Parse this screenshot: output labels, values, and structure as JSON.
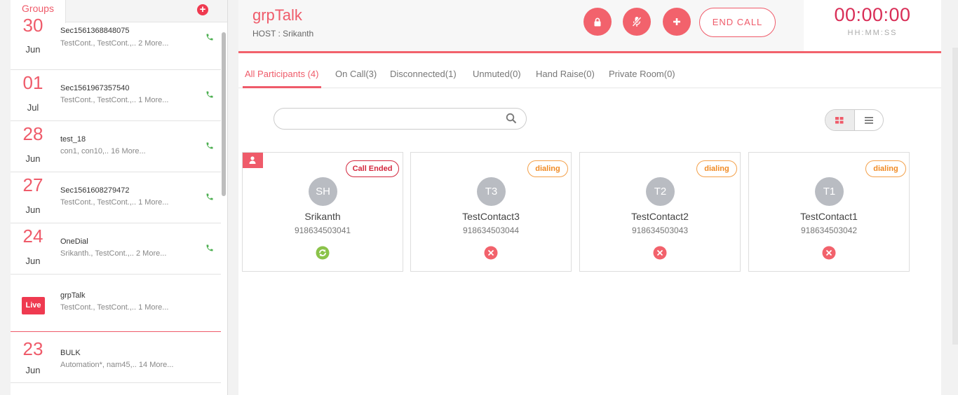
{
  "sidebar": {
    "tab_label": "Groups",
    "add_icon": "plus-circle-icon",
    "groups": [
      {
        "day": "30",
        "month": "Jun",
        "name": "Sec1561368848075",
        "members": "TestCont.,  TestCont.,.. 2 More..."
      },
      {
        "day": "01",
        "month": "Jul",
        "name": "Sec1561967357540",
        "members": "TestCont.,  TestCont.,.. 1 More..."
      },
      {
        "day": "28",
        "month": "Jun",
        "name": "test_18",
        "members": "con1,  con10,.. 16 More..."
      },
      {
        "day": "27",
        "month": "Jun",
        "name": "Sec1561608279472",
        "members": "TestCont.,  TestCont.,.. 1 More..."
      },
      {
        "day": "24",
        "month": "Jun",
        "name": "OneDial",
        "members": "Srikanth.,  TestCont.,.. 2 More..."
      },
      {
        "live": "Live",
        "name": "grpTalk",
        "members": "TestCont.,  TestCont.,.. 1 More..."
      },
      {
        "day": "23",
        "month": "Jun",
        "name": "BULK",
        "members": "Automation*,  nam45,.. 14 More..."
      }
    ]
  },
  "header": {
    "title": "grpTalk",
    "host": "HOST : Srikanth",
    "end_call": "END CALL",
    "timer": "00:00:00",
    "timer_format": "HH:MM:SS"
  },
  "tabs": [
    {
      "label": "All Participants (4)"
    },
    {
      "label": "On Call(3)"
    },
    {
      "label": "Disconnected(1)"
    },
    {
      "label": "Unmuted(0)"
    },
    {
      "label": "Hand Raise(0)"
    },
    {
      "label": "Private Room(0)"
    }
  ],
  "search": {
    "placeholder": ""
  },
  "participants": [
    {
      "initials": "SH",
      "name": "Srikanth",
      "phone": "918634503041",
      "status": "Call Ended",
      "state_icon": "refresh-icon"
    },
    {
      "initials": "T3",
      "name": "TestContact3",
      "phone": "918634503044",
      "status": "dialing",
      "state_icon": "close-icon"
    },
    {
      "initials": "T2",
      "name": "TestContact2",
      "phone": "918634503043",
      "status": "dialing",
      "state_icon": "close-icon"
    },
    {
      "initials": "T1",
      "name": "TestContact1",
      "phone": "918634503042",
      "status": "dialing",
      "state_icon": "close-icon"
    }
  ],
  "colors": {
    "accent": "#ef5b6a",
    "timer": "#d92e57",
    "dialing": "#f08a24",
    "ended": "#d3273d",
    "success": "#8bc34a",
    "phone": "#4caf50"
  }
}
